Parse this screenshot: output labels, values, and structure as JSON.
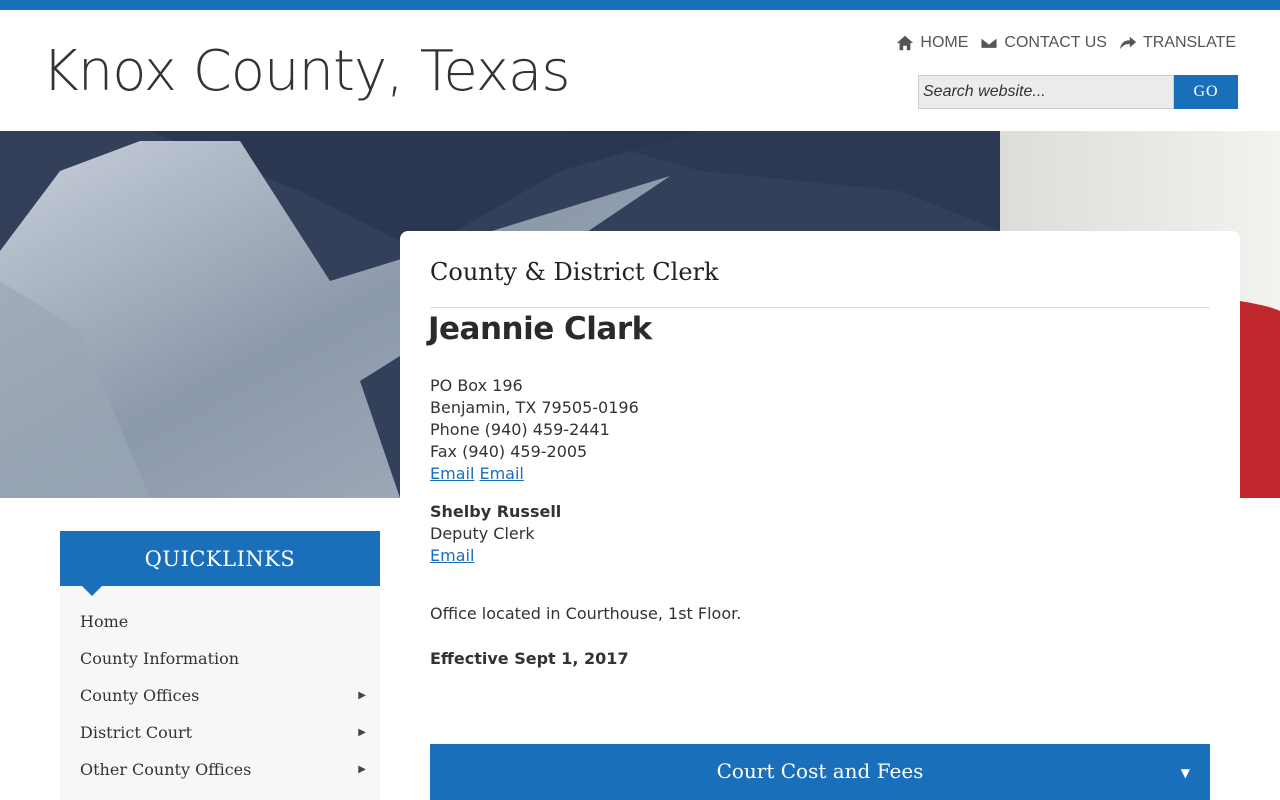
{
  "header": {
    "site_title": "Knox County, Texas",
    "nav": [
      {
        "label": "HOME",
        "icon": "home-icon"
      },
      {
        "label": "CONTACT US",
        "icon": "envelope-icon"
      },
      {
        "label": "TRANSLATE",
        "icon": "share-arrow-icon"
      }
    ],
    "search": {
      "placeholder": "Search website...",
      "button_label": "GO"
    }
  },
  "content": {
    "section_title": "County & District Clerk",
    "name": "Jeannie Clark",
    "address_lines": [
      "PO Box 196",
      "Benjamin, TX 79505-0196",
      "Phone (940) 459-2441",
      "Fax (940) 459-2005"
    ],
    "email_links": [
      "Email",
      "Email"
    ],
    "deputy": {
      "name": "Shelby Russell",
      "title": "Deputy Clerk",
      "email_label": "Email"
    },
    "office_location": "Office located in Courthouse, 1st Floor.",
    "effective": "Effective Sept 1, 2017",
    "accordion": {
      "label": "Court Cost and Fees",
      "caret": "▼"
    }
  },
  "quicklinks": {
    "title": "QUICKLINKS",
    "items": [
      {
        "label": "Home",
        "has_submenu": false
      },
      {
        "label": "County Information",
        "has_submenu": false
      },
      {
        "label": "County Offices",
        "has_submenu": true
      },
      {
        "label": "District Court",
        "has_submenu": true
      },
      {
        "label": "Other County Offices",
        "has_submenu": true
      }
    ]
  },
  "colors": {
    "accent": "#1a6fbb",
    "sidebar_bg": "#f7f7f7"
  }
}
